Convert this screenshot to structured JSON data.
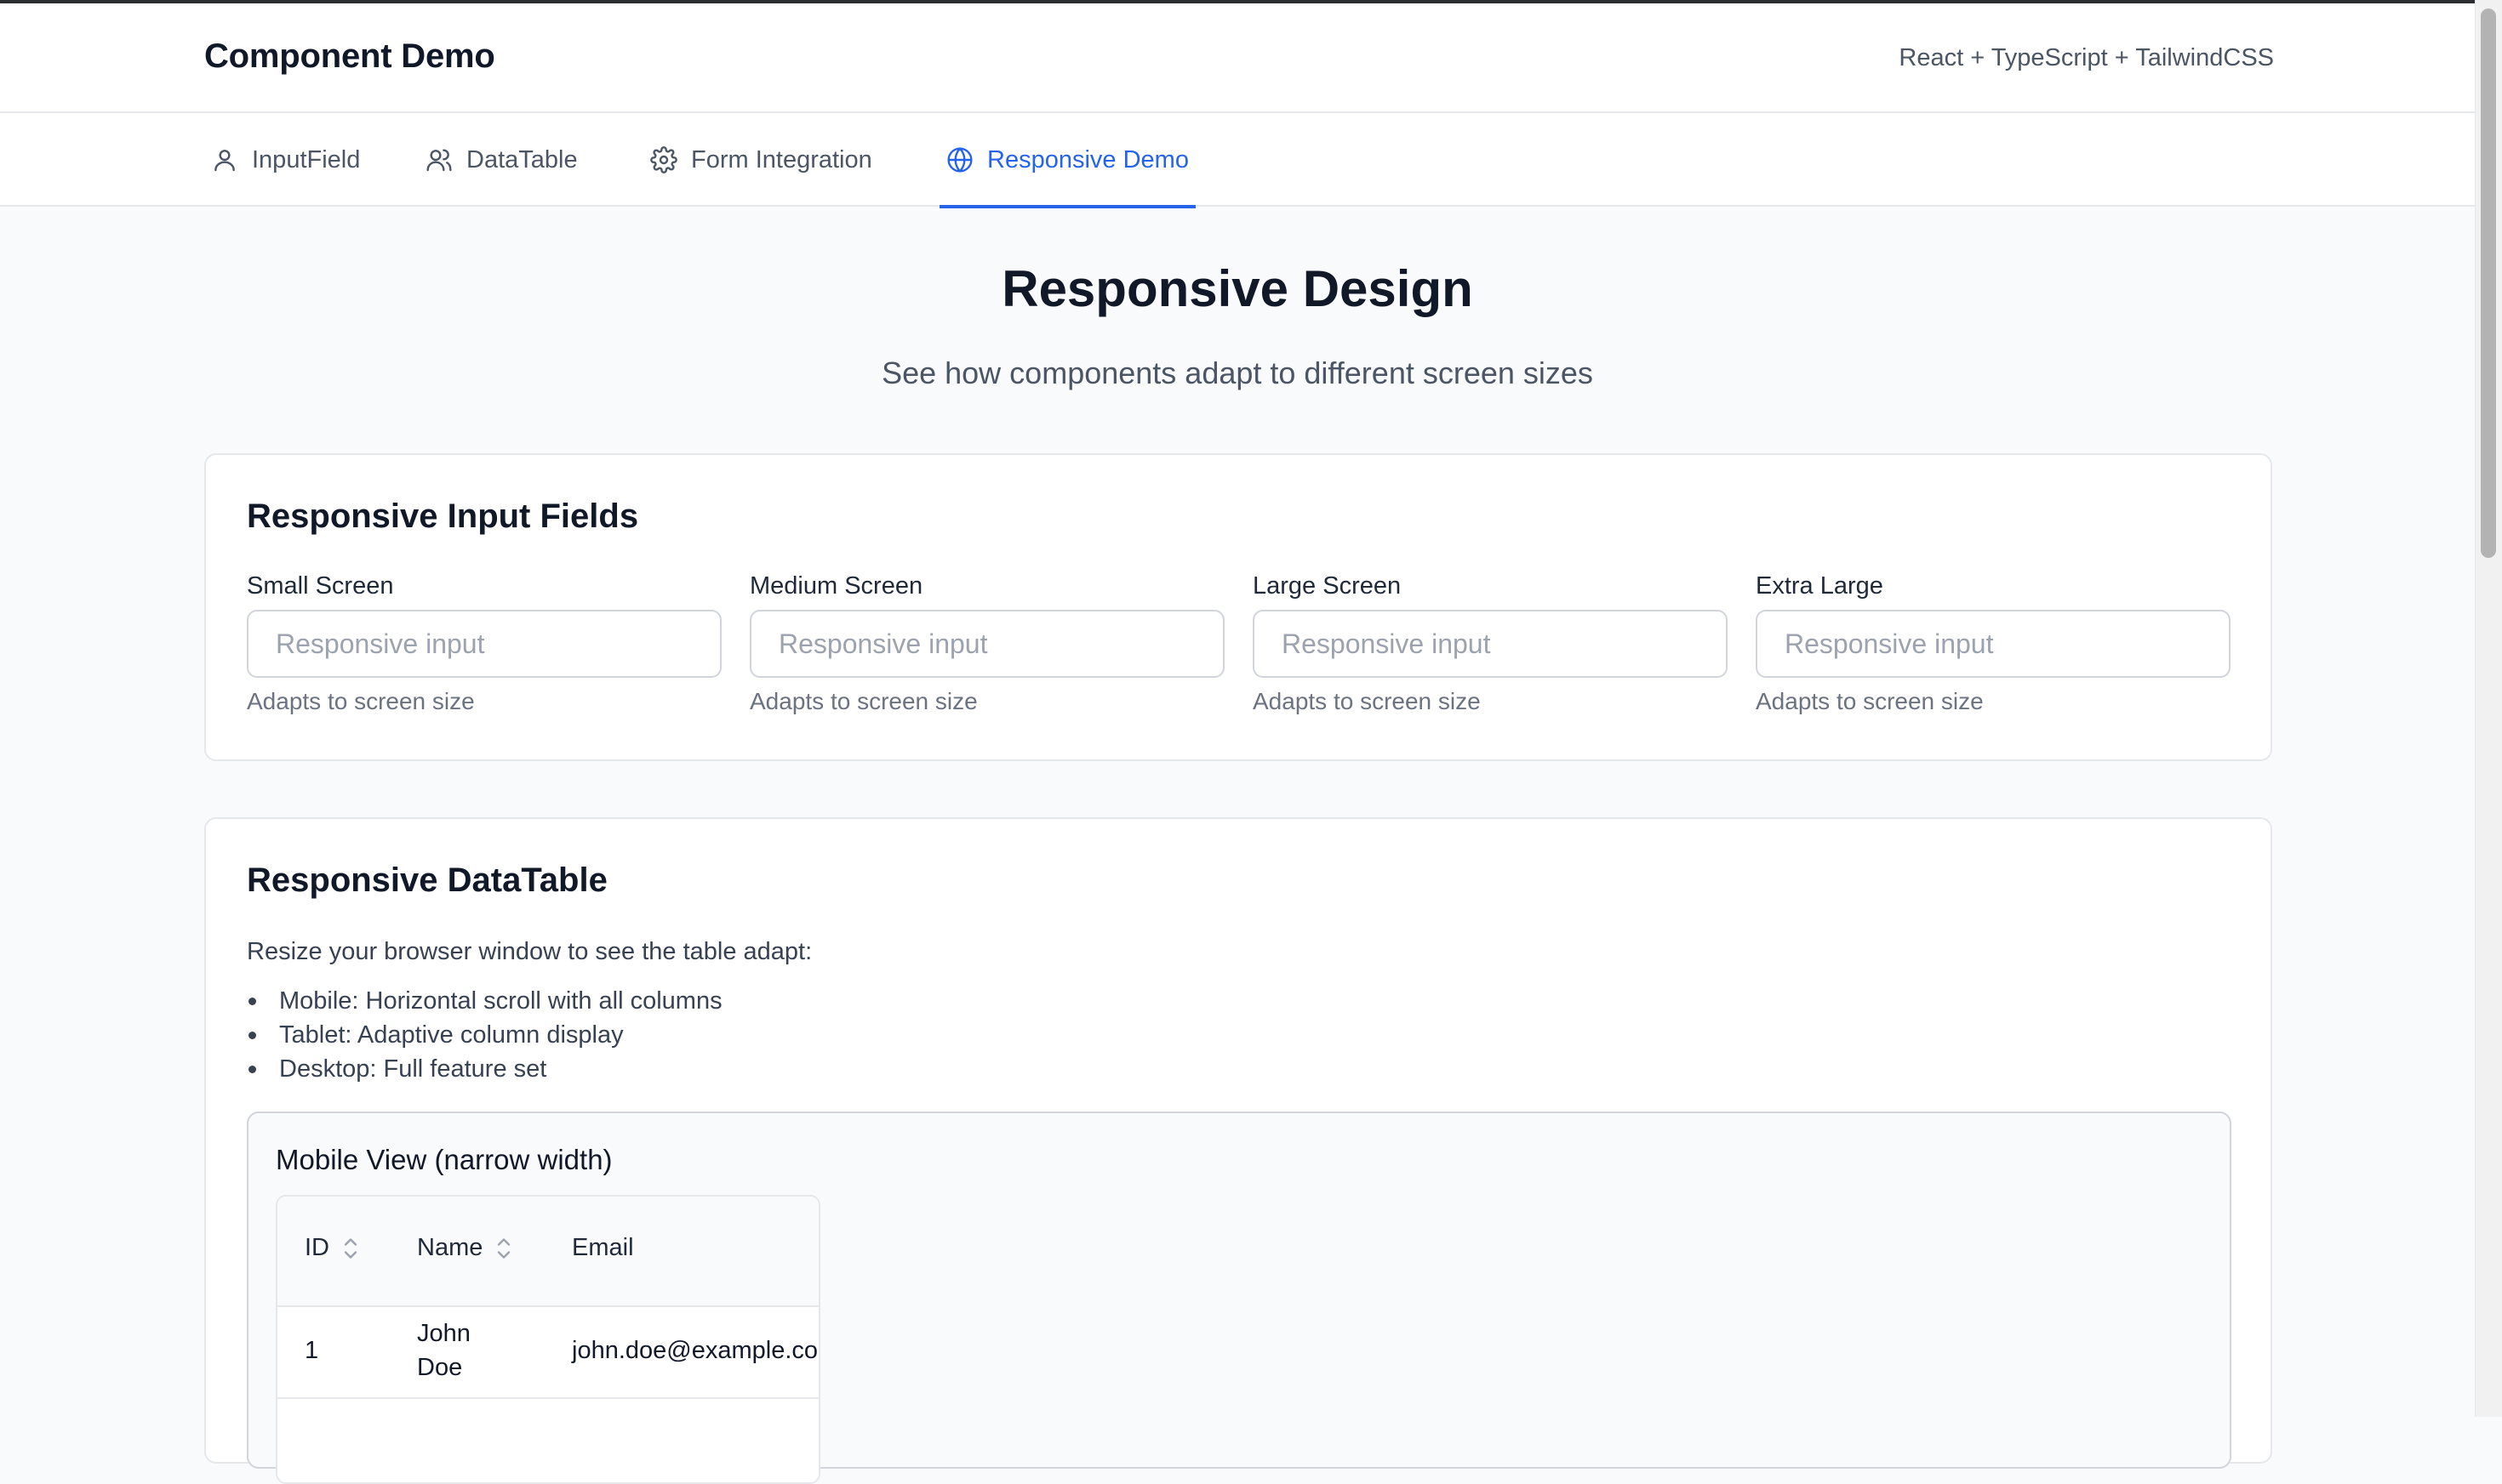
{
  "app": {
    "title": "Component Demo",
    "stack": "React + TypeScript + TailwindCSS"
  },
  "tabs": [
    {
      "label": "InputField",
      "icon": "user-icon",
      "active": false
    },
    {
      "label": "DataTable",
      "icon": "users-icon",
      "active": false
    },
    {
      "label": "Form Integration",
      "icon": "gear-icon",
      "active": false
    },
    {
      "label": "Responsive Demo",
      "icon": "globe-icon",
      "active": true
    }
  ],
  "page": {
    "title": "Responsive Design",
    "subtitle": "See how components adapt to different screen sizes"
  },
  "inputs_card": {
    "title": "Responsive Input Fields",
    "fields": [
      {
        "label": "Small Screen",
        "placeholder": "Responsive input",
        "value": "",
        "help": "Adapts to screen size"
      },
      {
        "label": "Medium Screen",
        "placeholder": "Responsive input",
        "value": "",
        "help": "Adapts to screen size"
      },
      {
        "label": "Large Screen",
        "placeholder": "Responsive input",
        "value": "",
        "help": "Adapts to screen size"
      },
      {
        "label": "Extra Large",
        "placeholder": "Responsive input",
        "value": "",
        "help": "Adapts to screen size"
      }
    ]
  },
  "table_card": {
    "title": "Responsive DataTable",
    "description": "Resize your browser window to see the table adapt:",
    "bullets": [
      "Mobile: Horizontal scroll with all columns",
      "Tablet: Adaptive column display",
      "Desktop: Full feature set"
    ],
    "mobile_view": {
      "title": "Mobile View (narrow width)",
      "columns": [
        {
          "label": "ID",
          "sortable": true
        },
        {
          "label": "Name",
          "sortable": true
        },
        {
          "label": "Email",
          "sortable": false
        }
      ],
      "rows": [
        {
          "id": "1",
          "name_first": "John",
          "name_last": "Doe",
          "email": "john.doe@example.com"
        }
      ]
    }
  },
  "colors": {
    "accent": "#2563eb",
    "background": "#f8fafc",
    "border": "#e5e7eb"
  }
}
